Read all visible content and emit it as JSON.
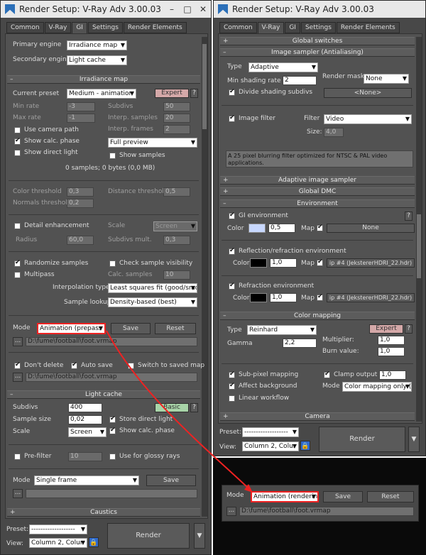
{
  "left": {
    "title": "Render Setup: V-Ray Adv 3.00.03",
    "tabs": [
      "Common",
      "V-Ray",
      "GI",
      "Settings",
      "Render Elements"
    ],
    "primary_engine_label": "Primary engine",
    "primary_engine": "Irradiance map",
    "secondary_engine_label": "Secondary engine",
    "secondary_engine": "Light cache",
    "irr_title": "Irradiance map",
    "current_preset_label": "Current preset",
    "current_preset": "Medium - animation",
    "expert": "Expert",
    "help": "?",
    "min_rate_label": "Min rate",
    "min_rate": "-3",
    "max_rate_label": "Max rate",
    "max_rate": "-1",
    "subdivs_label": "Subdivs",
    "subdivs": "50",
    "interp_samples_label": "Interp. samples",
    "interp_samples": "20",
    "interp_frames_label": "Interp. frames",
    "interp_frames": "2",
    "use_camera_path": "Use camera path",
    "show_calc_phase": "Show calc. phase",
    "show_direct_light": "Show direct light",
    "preview": "Full preview",
    "show_samples": "Show samples",
    "samples_info": "0 samples; 0 bytes (0,0 MB)",
    "color_threshold_label": "Color threshold",
    "color_threshold": "0,3",
    "distance_threshold_label": "Distance threshold",
    "distance_threshold": "0,5",
    "normals_threshold_label": "Normals threshold",
    "normals_threshold": "0,2",
    "detail_enh": "Detail enhancement",
    "scale_label": "Scale",
    "scale_val": "Screen",
    "radius_label": "Radius",
    "radius": "60,0",
    "subdivs_mult_label": "Subdivs mult.",
    "subdivs_mult": "0,3",
    "randomize": "Randomize samples",
    "check_vis": "Check sample visibility",
    "multipass": "Multipass",
    "calc_samples_label": "Calc. samples",
    "calc_samples": "10",
    "interp_type_label": "Interpolation type",
    "interp_type": "Least squares fit (good/smo",
    "sample_lookup_label": "Sample lookup",
    "sample_lookup": "Density-based (best)",
    "mode_label": "Mode",
    "mode": "Animation (prepass",
    "save": "Save",
    "reset": "Reset",
    "browse": "...",
    "path": "D:\\fume\\football\\foot.vrmap",
    "dont_delete": "Don't delete",
    "auto_save": "Auto save",
    "switch_saved": "Switch to saved map",
    "autosave_path": "D:\\fume\\football\\foot.vrmap",
    "lc_title": "Light cache",
    "lc_subdivs_label": "Subdivs",
    "lc_subdivs": "400",
    "basic": "Basic",
    "sample_size_label": "Sample size",
    "sample_size": "0,02",
    "store_direct": "Store direct light",
    "lc_scale_label": "Scale",
    "lc_scale": "Screen",
    "lc_show_calc": "Show calc. phase",
    "prefilter": "Pre-filter",
    "prefilter_val": "10",
    "glossy_rays": "Use for glossy rays",
    "lc_mode_label": "Mode",
    "lc_mode": "Single frame",
    "lc_save": "Save",
    "lc_browse": "...",
    "caustics": "Caustics",
    "preset_label": "Preset:",
    "preset": "-------------------",
    "view_label": "View:",
    "view": "Column 2, Colur",
    "render": "Render"
  },
  "right": {
    "title": "Render Setup: V-Ray Adv 3.00.03",
    "tabs": [
      "Common",
      "V-Ray",
      "GI",
      "Settings",
      "Render Elements"
    ],
    "global_switches": "Global switches",
    "img_sampler": "Image sampler (Antialiasing)",
    "type_label": "Type",
    "type": "Adaptive",
    "min_shading_label": "Min shading rate",
    "min_shading": "2",
    "render_mask_label": "Render mask",
    "render_mask": "None",
    "divide_shading": "Divide shading subdivs",
    "none_btn": "<None>",
    "image_filter": "Image filter",
    "filter_label": "Filter",
    "filter": "Video",
    "size_label": "Size:",
    "size": "4,0",
    "filter_desc": "A 25 pixel  blurring filter optimized for NTSC & PAL video applications.",
    "adaptive_sampler": "Adaptive image sampler",
    "global_dmc": "Global DMC",
    "environment": "Environment",
    "gi_env": "GI environment",
    "color_label": "Color",
    "gi_mult": "0,5",
    "map_label": "Map",
    "gi_map": "None",
    "refl_env": "Reflection/refraction environment",
    "refl_mult": "1,0",
    "refl_map": "ip #4 (JekstererHDRI_22.hdr)",
    "refr_env": "Refraction environment",
    "refr_mult": "1,0",
    "refr_map": "ip #4 (JekstererHDRI_22.hdr)",
    "color_mapping": "Color mapping",
    "cm_type_label": "Type",
    "cm_type": "Reinhard",
    "expert": "Expert",
    "help": "?",
    "gamma_label": "Gamma",
    "gamma": "2,2",
    "multiplier_label": "Multiplier:",
    "multiplier": "1,0",
    "burn_label": "Burn value:",
    "burn": "1,0",
    "subpixel": "Sub-pixel mapping",
    "clamp": "Clamp output",
    "clamp_val": "1,0",
    "affect_bg": "Affect background",
    "cm_mode_label": "Mode",
    "cm_mode": "Color mapping only (",
    "linear_wf": "Linear workflow",
    "camera": "Camera",
    "preset_label": "Preset:",
    "preset": "-------------------",
    "view_label": "View:",
    "view": "Column 2, Colur",
    "render": "Render"
  },
  "inset": {
    "mode_label": "Mode",
    "mode": "Animation (renderin",
    "save": "Save",
    "reset": "Reset",
    "browse": "...",
    "path": "D:\\fume\\football\\foot.vrmap"
  },
  "colors": {
    "annotation": "#ee2222",
    "gi_color": "#c8d8ff"
  }
}
